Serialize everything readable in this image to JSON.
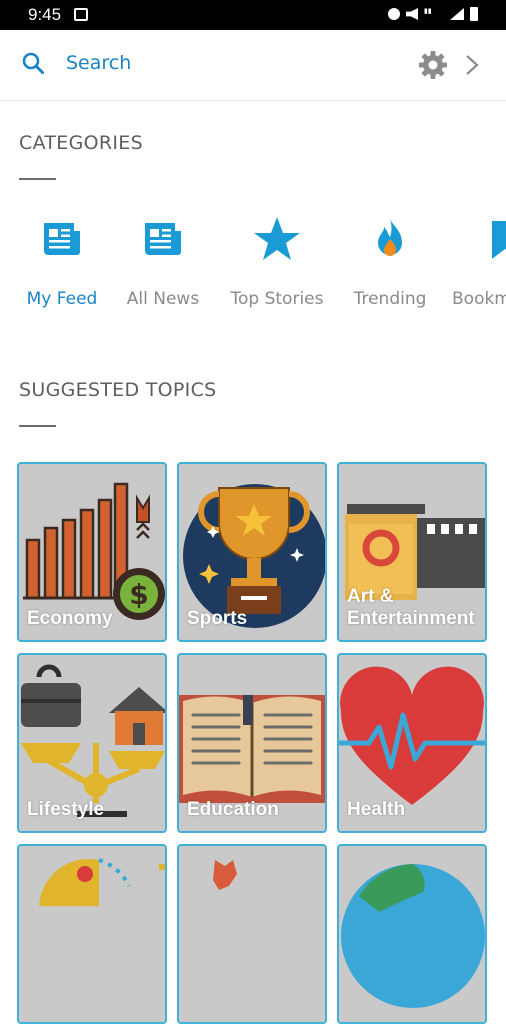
{
  "status_bar": {
    "time": "9:45"
  },
  "search": {
    "label": "Search"
  },
  "categories": {
    "title": "CATEGORIES",
    "items": [
      {
        "label": "My Feed",
        "icon": "news-feed-icon",
        "active": true
      },
      {
        "label": "All News",
        "icon": "newspaper-icon",
        "active": false
      },
      {
        "label": "Top Stories",
        "icon": "star-icon",
        "active": false
      },
      {
        "label": "Trending",
        "icon": "flame-icon",
        "active": false
      },
      {
        "label": "Bookm",
        "icon": "bookmark-icon",
        "active": false
      }
    ]
  },
  "suggested": {
    "title": "SUGGESTED TOPICS",
    "topics": [
      {
        "label": "Economy"
      },
      {
        "label": "Sports"
      },
      {
        "label": "Art & Entertainment"
      },
      {
        "label": "Lifestyle"
      },
      {
        "label": "Education"
      },
      {
        "label": "Health"
      }
    ]
  },
  "colors": {
    "accent": "#1a84c7",
    "tile_border": "#41b1d8",
    "tile_bg": "#c9c9c9"
  }
}
